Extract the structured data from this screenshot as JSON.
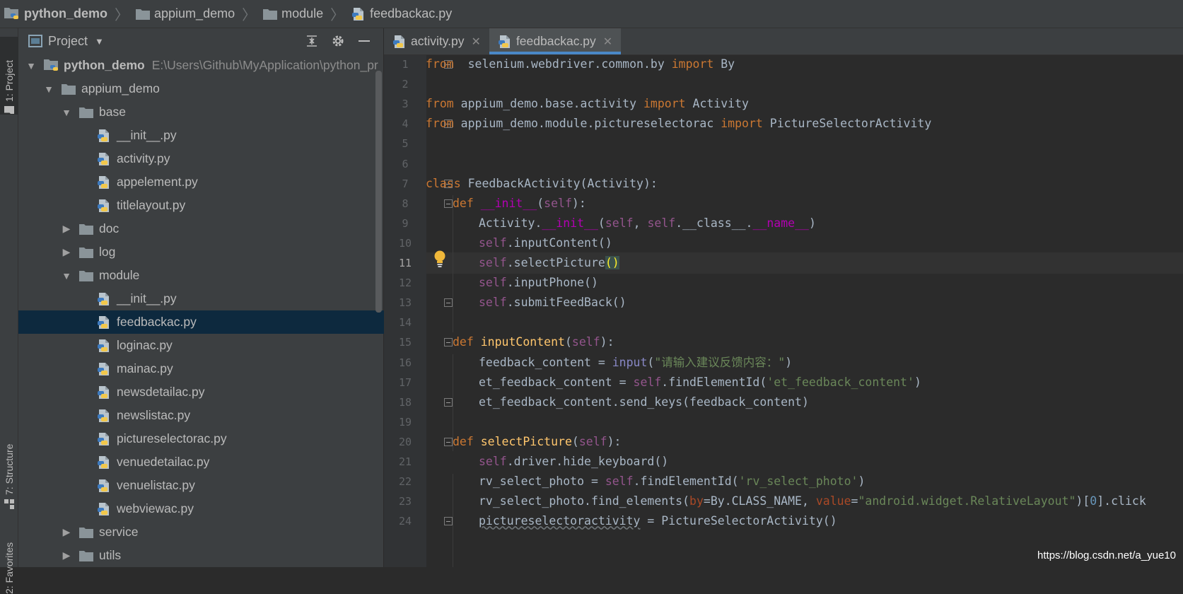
{
  "breadcrumb": {
    "items": [
      {
        "label": "python_demo",
        "icon": "python-project-icon"
      },
      {
        "label": "appium_demo",
        "icon": "folder-icon"
      },
      {
        "label": "module",
        "icon": "folder-icon"
      },
      {
        "label": "feedbackac.py",
        "icon": "python-file-icon"
      }
    ]
  },
  "left_strip": {
    "project_tab": "1: Project",
    "structure_tab": "7: Structure",
    "favorites_tab": "2: Favorites"
  },
  "project_panel": {
    "title": "Project",
    "tree": [
      {
        "label": "python_demo",
        "path": "E:\\Users\\Github\\MyApplication\\python_pr",
        "type": "root",
        "depth": 0,
        "expanded": true
      },
      {
        "label": "appium_demo",
        "type": "folder",
        "depth": 1,
        "expanded": true
      },
      {
        "label": "base",
        "type": "folder",
        "depth": 2,
        "expanded": true
      },
      {
        "label": "__init__.py",
        "type": "file",
        "depth": 3
      },
      {
        "label": "activity.py",
        "type": "file",
        "depth": 3
      },
      {
        "label": "appelement.py",
        "type": "file",
        "depth": 3
      },
      {
        "label": "titlelayout.py",
        "type": "file",
        "depth": 3
      },
      {
        "label": "doc",
        "type": "folder",
        "depth": 2,
        "expanded": false
      },
      {
        "label": "log",
        "type": "folder",
        "depth": 2,
        "expanded": false
      },
      {
        "label": "module",
        "type": "folder",
        "depth": 2,
        "expanded": true
      },
      {
        "label": "__init__.py",
        "type": "file",
        "depth": 3
      },
      {
        "label": "feedbackac.py",
        "type": "file",
        "depth": 3,
        "selected": true
      },
      {
        "label": "loginac.py",
        "type": "file",
        "depth": 3
      },
      {
        "label": "mainac.py",
        "type": "file",
        "depth": 3
      },
      {
        "label": "newsdetailac.py",
        "type": "file",
        "depth": 3
      },
      {
        "label": "newslistac.py",
        "type": "file",
        "depth": 3
      },
      {
        "label": "pictureselectorac.py",
        "type": "file",
        "depth": 3
      },
      {
        "label": "venuedetailac.py",
        "type": "file",
        "depth": 3
      },
      {
        "label": "venuelistac.py",
        "type": "file",
        "depth": 3
      },
      {
        "label": "webviewac.py",
        "type": "file",
        "depth": 3
      },
      {
        "label": "service",
        "type": "folder",
        "depth": 2,
        "expanded": false
      },
      {
        "label": "utils",
        "type": "folder",
        "depth": 2,
        "expanded": false
      }
    ]
  },
  "editor_tabs": [
    {
      "label": "activity.py",
      "active": false
    },
    {
      "label": "feedbackac.py",
      "active": true
    }
  ],
  "editor": {
    "current_line": 11,
    "lines": [
      {
        "n": "1",
        "fold": true,
        "indent": 0,
        "tokens": [
          [
            "kw",
            "from"
          ],
          [
            "",
            "  selenium.webdriver.common.by "
          ],
          [
            "kw",
            "import"
          ],
          [
            "",
            " By"
          ]
        ]
      },
      {
        "n": "2",
        "indent": 0,
        "tokens": []
      },
      {
        "n": "3",
        "indent": 0,
        "tokens": [
          [
            "kw",
            "from"
          ],
          [
            "",
            " appium_demo.base.activity "
          ],
          [
            "kw",
            "import"
          ],
          [
            "",
            " Activity"
          ]
        ]
      },
      {
        "n": "4",
        "fold": true,
        "indent": 0,
        "tokens": [
          [
            "kw",
            "from"
          ],
          [
            "",
            " appium_demo.module.pictureselectorac "
          ],
          [
            "kw",
            "import"
          ],
          [
            "",
            " PictureSelectorActivity"
          ]
        ]
      },
      {
        "n": "5",
        "indent": 0,
        "tokens": []
      },
      {
        "n": "6",
        "indent": 0,
        "tokens": []
      },
      {
        "n": "7",
        "fold": true,
        "indent": 0,
        "tokens": [
          [
            "kw",
            "class"
          ],
          [
            "",
            " FeedbackActivity(Activity):"
          ]
        ]
      },
      {
        "n": "8",
        "fold": true,
        "indent": 1,
        "tokens": [
          [
            "kw",
            "def"
          ],
          [
            "",
            " "
          ],
          [
            "mag",
            "__init__"
          ],
          [
            "",
            "("
          ],
          [
            "slf",
            "self"
          ],
          [
            "",
            "):"
          ]
        ]
      },
      {
        "n": "9",
        "indent": 2,
        "tokens": [
          [
            "",
            "Activity."
          ],
          [
            "mag",
            "__init__"
          ],
          [
            "",
            "("
          ],
          [
            "slf",
            "self"
          ],
          [
            "",
            ", "
          ],
          [
            "slf",
            "self"
          ],
          [
            "",
            ".__class__."
          ],
          [
            "mag",
            "__name__"
          ],
          [
            "",
            ")"
          ]
        ]
      },
      {
        "n": "10",
        "indent": 2,
        "tokens": [
          [
            "slf",
            "self"
          ],
          [
            "",
            ".inputContent()"
          ]
        ]
      },
      {
        "n": "11",
        "indent": 2,
        "bulb": true,
        "tokens": [
          [
            "slf",
            "self"
          ],
          [
            "",
            ".selectPicture"
          ],
          [
            "brm",
            "()"
          ]
        ]
      },
      {
        "n": "12",
        "indent": 2,
        "tokens": [
          [
            "slf",
            "self"
          ],
          [
            "",
            ".inputPhone()"
          ]
        ]
      },
      {
        "n": "13",
        "fold": true,
        "indent": 2,
        "tokens": [
          [
            "slf",
            "self"
          ],
          [
            "",
            ".submitFeedBack()"
          ]
        ]
      },
      {
        "n": "14",
        "indent": 0,
        "tokens": []
      },
      {
        "n": "15",
        "fold": true,
        "indent": 1,
        "tokens": [
          [
            "kw",
            "def"
          ],
          [
            "",
            " "
          ],
          [
            "fn",
            "inputContent"
          ],
          [
            "",
            "("
          ],
          [
            "slf",
            "self"
          ],
          [
            "",
            "):"
          ]
        ]
      },
      {
        "n": "16",
        "indent": 2,
        "tokens": [
          [
            "",
            "feedback_content = "
          ],
          [
            "bi",
            "input"
          ],
          [
            "",
            "("
          ],
          [
            "str",
            "\"请输入建议反馈内容：\""
          ],
          [
            "",
            ")"
          ]
        ]
      },
      {
        "n": "17",
        "indent": 2,
        "tokens": [
          [
            "",
            "et_feedback_content = "
          ],
          [
            "slf",
            "self"
          ],
          [
            "",
            ".findElementId("
          ],
          [
            "str",
            "'et_feedback_content'"
          ],
          [
            "",
            ")"
          ]
        ]
      },
      {
        "n": "18",
        "fold": true,
        "indent": 2,
        "tokens": [
          [
            "",
            "et_feedback_content.send_keys(feedback_content)"
          ]
        ]
      },
      {
        "n": "19",
        "indent": 0,
        "tokens": []
      },
      {
        "n": "20",
        "fold": true,
        "indent": 1,
        "tokens": [
          [
            "kw",
            "def"
          ],
          [
            "",
            " "
          ],
          [
            "fn",
            "selectPicture"
          ],
          [
            "",
            "("
          ],
          [
            "slf",
            "self"
          ],
          [
            "",
            "):"
          ]
        ]
      },
      {
        "n": "21",
        "indent": 2,
        "tokens": [
          [
            "slf",
            "self"
          ],
          [
            "",
            ".driver.hide_keyboard()"
          ]
        ]
      },
      {
        "n": "22",
        "indent": 2,
        "tokens": [
          [
            "",
            "rv_select_photo = "
          ],
          [
            "slf",
            "self"
          ],
          [
            "",
            ".findElementId("
          ],
          [
            "str",
            "'rv_select_photo'"
          ],
          [
            "",
            ")"
          ]
        ]
      },
      {
        "n": "23",
        "indent": 2,
        "tokens": [
          [
            "",
            "rv_select_photo.find_elements("
          ],
          [
            "kwarg",
            "by"
          ],
          [
            "",
            "=By.CLASS_NAME, "
          ],
          [
            "kwarg",
            "value"
          ],
          [
            "",
            "="
          ],
          [
            "str",
            "\"android.widget.RelativeLayout\""
          ],
          [
            "",
            ")["
          ],
          [
            "num",
            "0"
          ],
          [
            "",
            "].click"
          ]
        ]
      },
      {
        "n": "24",
        "fold": true,
        "indent": 2,
        "tokens": [
          [
            "wavy",
            "pictureselectoractivity"
          ],
          [
            "",
            " = PictureSelectorActivity()"
          ]
        ]
      }
    ]
  },
  "watermark": "https://blog.csdn.net/a_yue10",
  "colors": {
    "accent": "#4a88c7",
    "selection": "#0d293e",
    "keyword": "#cc7832",
    "string": "#6a8759"
  }
}
